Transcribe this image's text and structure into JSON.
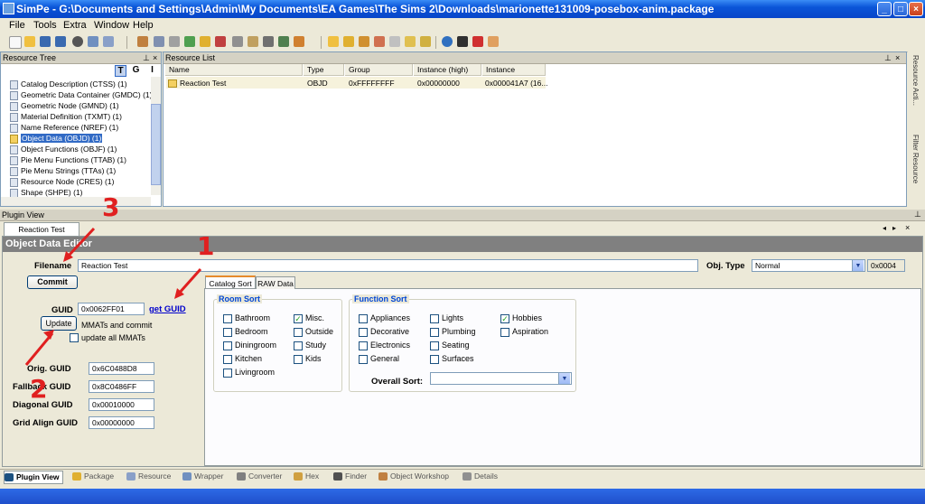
{
  "window": {
    "title": "SimPe - G:\\Documents and Settings\\Admin\\My Documents\\EA Games\\The Sims 2\\Downloads\\marionette131009-posebox-anim.package",
    "controls": [
      "_",
      "□",
      "×"
    ]
  },
  "menu": [
    "File",
    "Tools",
    "Extra",
    "Window",
    "Help"
  ],
  "tree": {
    "title": "Resource Tree",
    "view_buttons": [
      "T",
      "G",
      "I"
    ],
    "items": [
      "Catalog Description (CTSS) (1)",
      "Geometric Data Container (GMDC) (1)",
      "Geometric Node (GMND) (1)",
      "Material Definition (TXMT) (1)",
      "Name Reference (NREF) (1)",
      "Object Data (OBJD) (1)",
      "Object Functions (OBJF) (1)",
      "Pie Menu Functions (TTAB) (1)",
      "Pie Menu Strings (TTAs) (1)",
      "Resource Node (CRES) (1)",
      "Shape (SHPE) (1)"
    ],
    "selected_index": 5
  },
  "resource_list": {
    "title": "Resource List",
    "columns": [
      "Name",
      "Type",
      "Group",
      "Instance (high)",
      "Instance"
    ],
    "rows": [
      [
        "Reaction Test",
        "OBJD",
        "0xFFFFFFFF",
        "0x00000000",
        "0x000041A7 (16..."
      ]
    ]
  },
  "side_strip": [
    "Resource Acti...",
    "Filter Resource"
  ],
  "plugin_view": {
    "title": "Plugin View",
    "tab": "Reaction Test",
    "editor_title": "Object Data Editor",
    "filename_label": "Filename",
    "filename_value": "Reaction Test",
    "objtype_label": "Obj. Type",
    "objtype_value": "Normal",
    "objtype_code": "0x0004",
    "commit_label": "Commit",
    "guid_label": "GUID",
    "guid_value": "0x0062FF01",
    "get_guid": "get GUID",
    "update_label": "Update",
    "mmats_text": "MMATs and commit",
    "update_all": "update all MMATs",
    "orig_guid_label": "Orig. GUID",
    "orig_guid_value": "0x6C0488D8",
    "fallback_guid_label": "Fallback GUID",
    "fallback_guid_value": "0x8C0486FF",
    "diagonal_guid_label": "Diagonal GUID",
    "diagonal_guid_value": "0x00010000",
    "grid_align_guid_label": "Grid Align GUID",
    "grid_align_guid_value": "0x00000000",
    "tabs": [
      "Catalog Sort",
      "RAW Data"
    ],
    "room_sort": {
      "title": "Room Sort",
      "items": [
        {
          "label": "Bathroom",
          "checked": false
        },
        {
          "label": "Bedroom",
          "checked": false
        },
        {
          "label": "Diningroom",
          "checked": false
        },
        {
          "label": "Kitchen",
          "checked": false
        },
        {
          "label": "Livingroom",
          "checked": false
        },
        {
          "label": "Misc.",
          "checked": true
        },
        {
          "label": "Outside",
          "checked": false
        },
        {
          "label": "Study",
          "checked": false
        },
        {
          "label": "Kids",
          "checked": false
        }
      ]
    },
    "function_sort": {
      "title": "Function Sort",
      "items": [
        {
          "label": "Appliances",
          "checked": false
        },
        {
          "label": "Decorative",
          "checked": false
        },
        {
          "label": "Electronics",
          "checked": false
        },
        {
          "label": "General",
          "checked": false
        },
        {
          "label": "Lights",
          "checked": false
        },
        {
          "label": "Plumbing",
          "checked": false
        },
        {
          "label": "Seating",
          "checked": false
        },
        {
          "label": "Surfaces",
          "checked": false
        },
        {
          "label": "Hobbies",
          "checked": true
        },
        {
          "label": "Aspiration",
          "checked": false
        }
      ],
      "overall_sort_label": "Overall Sort:",
      "overall_sort_value": ""
    }
  },
  "bottom_tabs": [
    "Plugin View",
    "Package",
    "Resource",
    "Wrapper",
    "Converter",
    "Hex",
    "Finder",
    "Object Workshop",
    "Details"
  ],
  "annotations": [
    "1",
    "2",
    "3"
  ]
}
